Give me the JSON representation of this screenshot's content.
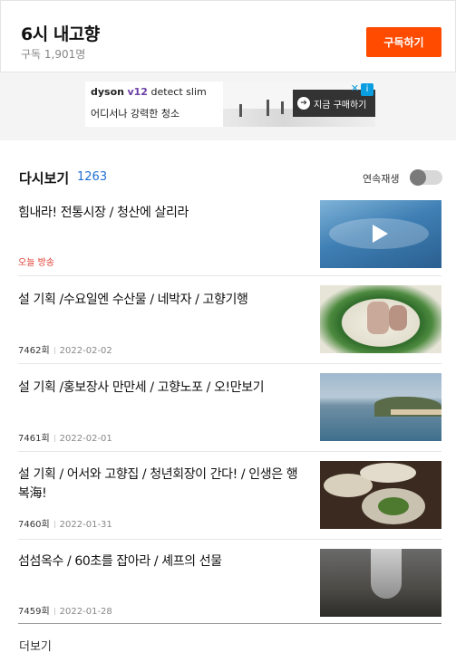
{
  "header": {
    "title": "6시 내고향",
    "subscribers": "구독 1,901명",
    "subscribe_label": "구독하기",
    "accent": "#ff4b00"
  },
  "ad": {
    "brand": "dyson",
    "model": "v12",
    "product": "detect slim",
    "copy": "어디서나 강력한 청소",
    "cta": "지금 구매하기",
    "close": "✕",
    "choice": "i"
  },
  "section": {
    "title": "다시보기",
    "count": "1263",
    "autoplay_label": "연속재생"
  },
  "episodes": [
    {
      "title": "힘내라! 전통시장 / 청산에 살리라",
      "live": "오늘 방송"
    },
    {
      "title": "설 기획 /수요일엔 수산물 / 네박자 / 고향기행",
      "number": "7462회",
      "date": "2022-02-02"
    },
    {
      "title": "설 기획 /홍보장사 만만세 / 고향노포 / 오!만보기",
      "number": "7461회",
      "date": "2022-02-01"
    },
    {
      "title": "설 기획 / 어서와 고향집 / 청년회장이 간다! / 인생은 행복海!",
      "number": "7460회",
      "date": "2022-01-31"
    },
    {
      "title": "섬섬옥수 / 60초를 잡아라 / 셰프의 선물",
      "number": "7459회",
      "date": "2022-01-28"
    }
  ],
  "more_label": "더보기"
}
